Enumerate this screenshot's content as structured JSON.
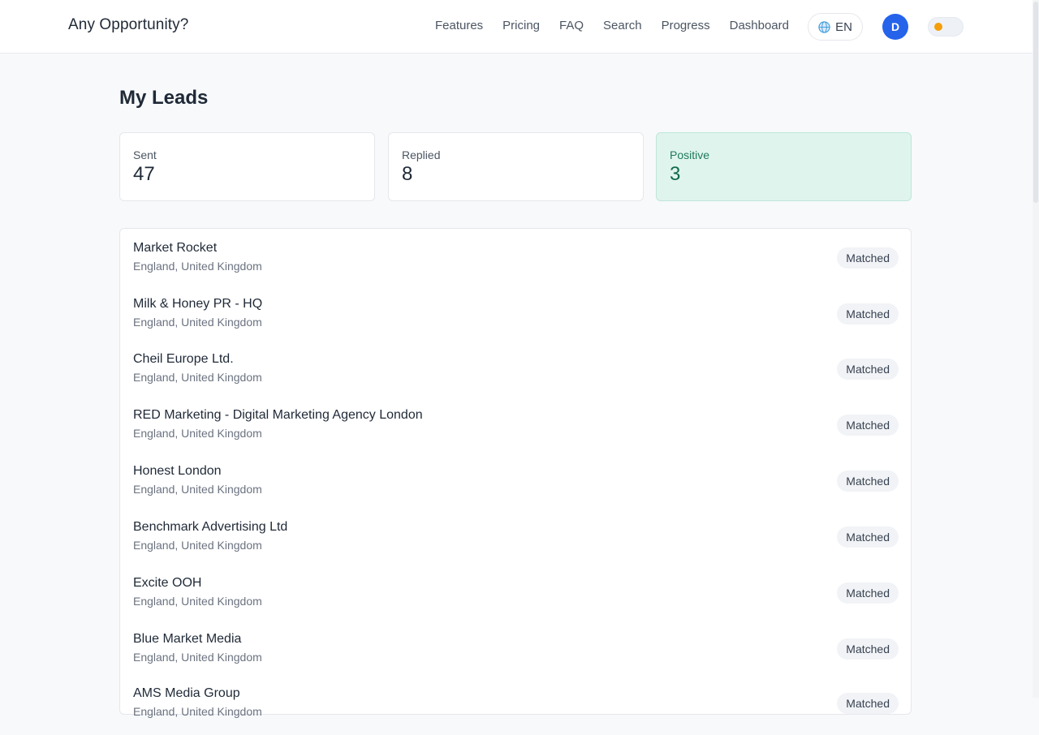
{
  "brand": "Any Opportunity?",
  "nav": [
    "Features",
    "Pricing",
    "FAQ",
    "Search",
    "Progress",
    "Dashboard"
  ],
  "language": "EN",
  "user_initial": "D",
  "page_title": "My Leads",
  "stats": {
    "sent": {
      "label": "Sent",
      "value": "47"
    },
    "replied": {
      "label": "Replied",
      "value": "8"
    },
    "positive": {
      "label": "Positive",
      "value": "3"
    }
  },
  "leads": [
    {
      "name": "Market Rocket",
      "location": "England, United Kingdom",
      "status": "Matched"
    },
    {
      "name": "Milk & Honey PR - HQ",
      "location": "England, United Kingdom",
      "status": "Matched"
    },
    {
      "name": "Cheil Europe Ltd.",
      "location": "England, United Kingdom",
      "status": "Matched"
    },
    {
      "name": "RED Marketing - Digital Marketing Agency London",
      "location": "England, United Kingdom",
      "status": "Matched"
    },
    {
      "name": "Honest London",
      "location": "England, United Kingdom",
      "status": "Matched"
    },
    {
      "name": "Benchmark Advertising Ltd",
      "location": "England, United Kingdom",
      "status": "Matched"
    },
    {
      "name": "Excite OOH",
      "location": "England, United Kingdom",
      "status": "Matched"
    },
    {
      "name": "Blue Market Media",
      "location": "England, United Kingdom",
      "status": "Matched"
    },
    {
      "name": "AMS Media Group",
      "location": "England, United Kingdom",
      "status": "Matched"
    }
  ]
}
